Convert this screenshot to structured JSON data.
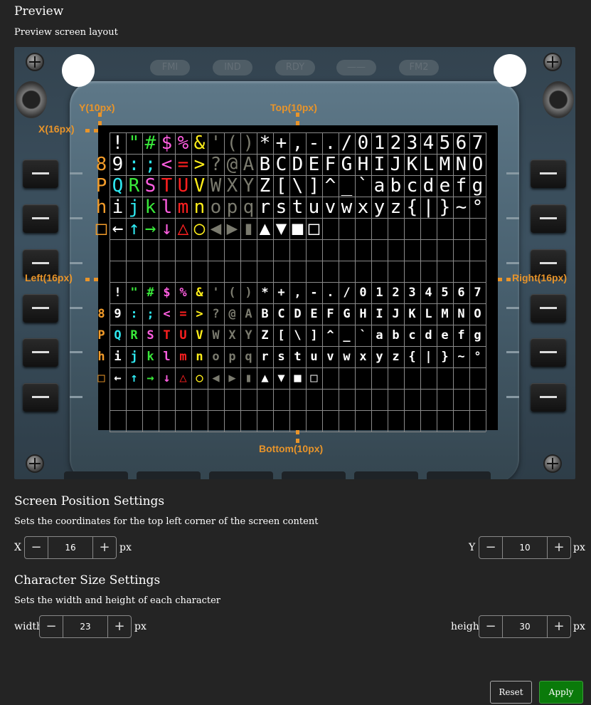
{
  "header": {
    "title": "Preview",
    "subtitle": "Preview screen layout"
  },
  "device": {
    "indicators": [
      "FMI",
      "IND",
      "RDY",
      "——",
      "FM2"
    ],
    "grid_rows": [
      [
        " ",
        "!",
        "\"",
        "#",
        "$",
        "%",
        "&",
        "'",
        "(",
        ")",
        "*",
        "+",
        ",",
        "-",
        ".",
        "/",
        "0",
        "1",
        "2",
        "3",
        "4",
        "5",
        "6",
        "7"
      ],
      [
        "8",
        "9",
        ":",
        ";",
        "<",
        "=",
        ">",
        "?",
        "@",
        "A",
        "B",
        "C",
        "D",
        "E",
        "F",
        "G",
        "H",
        "I",
        "J",
        "K",
        "L",
        "M",
        "N",
        "O"
      ],
      [
        "P",
        "Q",
        "R",
        "S",
        "T",
        "U",
        "V",
        "W",
        "X",
        "Y",
        "Z",
        "[",
        "\\",
        "]",
        "^",
        "_",
        "`",
        "a",
        "b",
        "c",
        "d",
        "e",
        "f",
        "g"
      ],
      [
        "h",
        "i",
        "j",
        "k",
        "l",
        "m",
        "n",
        "o",
        "p",
        "q",
        "r",
        "s",
        "t",
        "u",
        "v",
        "w",
        "x",
        "y",
        "z",
        "{",
        "|",
        "}",
        "~",
        "°"
      ],
      [
        "□",
        "←",
        "↑",
        "→",
        "↓",
        "△",
        "○",
        "◀",
        "▶",
        "▮",
        "▲",
        "▼",
        "■",
        "□",
        "",
        "",
        "",
        "",
        "",
        "",
        "",
        "",
        "",
        ""
      ]
    ],
    "colors": {
      "white": "#ffffff",
      "amber": "#f39c2a",
      "cyan": "#2ee8f0",
      "green": "#39e83a",
      "magenta": "#ff5ee0",
      "red": "#ff2020",
      "yellow": "#ffee1a",
      "grey": "#7a7a6e"
    },
    "overlay_labels": {
      "y": "Y(10px)",
      "top": "Top(10px)",
      "x": "X(16px)",
      "left": "Left(16px)",
      "right": "Right(16px)",
      "bottom": "Bottom(10px)"
    }
  },
  "position": {
    "title": "Screen Position Settings",
    "description": "Sets the coordinates for the top left corner of the screen content",
    "x_label": "X",
    "x_value": "16",
    "y_label": "Y",
    "y_value": "10",
    "unit": "px"
  },
  "size": {
    "title": "Character Size Settings",
    "description": "Sets the width and height of each character",
    "width_label": "width",
    "width_value": "23",
    "height_label": "height",
    "height_value": "30",
    "unit": "px"
  },
  "stepper": {
    "minus": "−",
    "plus": "+"
  },
  "actions": {
    "reset": "Reset",
    "apply": "Apply",
    "apply_color": "#0a7a0a"
  }
}
